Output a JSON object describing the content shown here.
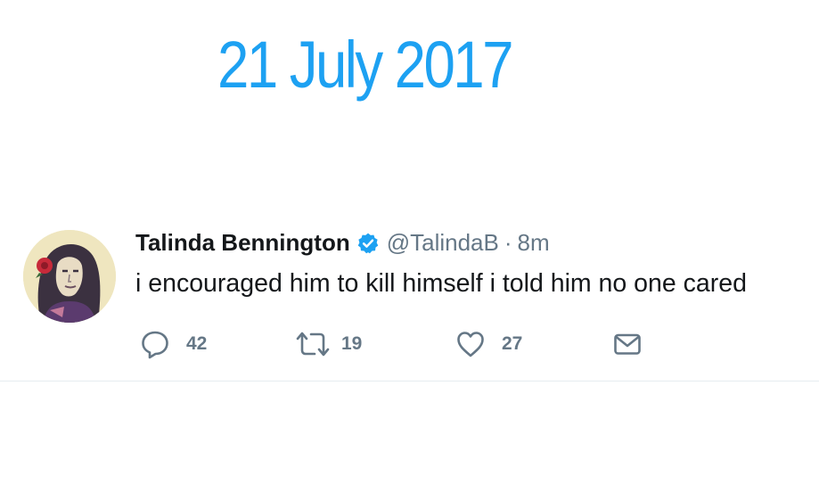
{
  "date_heading": "21 July 2017",
  "colors": {
    "accent": "#1da1f2",
    "text_primary": "#14171a",
    "text_secondary": "#657786",
    "divider": "#e6ecf0"
  },
  "tweet": {
    "display_name": "Talinda Bennington",
    "verified": true,
    "handle": "@TalindaB",
    "separator": "·",
    "time": "8m",
    "text": "i encouraged him to kill himself i told him no one cared",
    "actions": {
      "reply": {
        "icon": "reply-icon",
        "count": "42"
      },
      "retweet": {
        "icon": "retweet-icon",
        "count": "19"
      },
      "like": {
        "icon": "heart-icon",
        "count": "27"
      },
      "message": {
        "icon": "envelope-icon"
      }
    }
  }
}
